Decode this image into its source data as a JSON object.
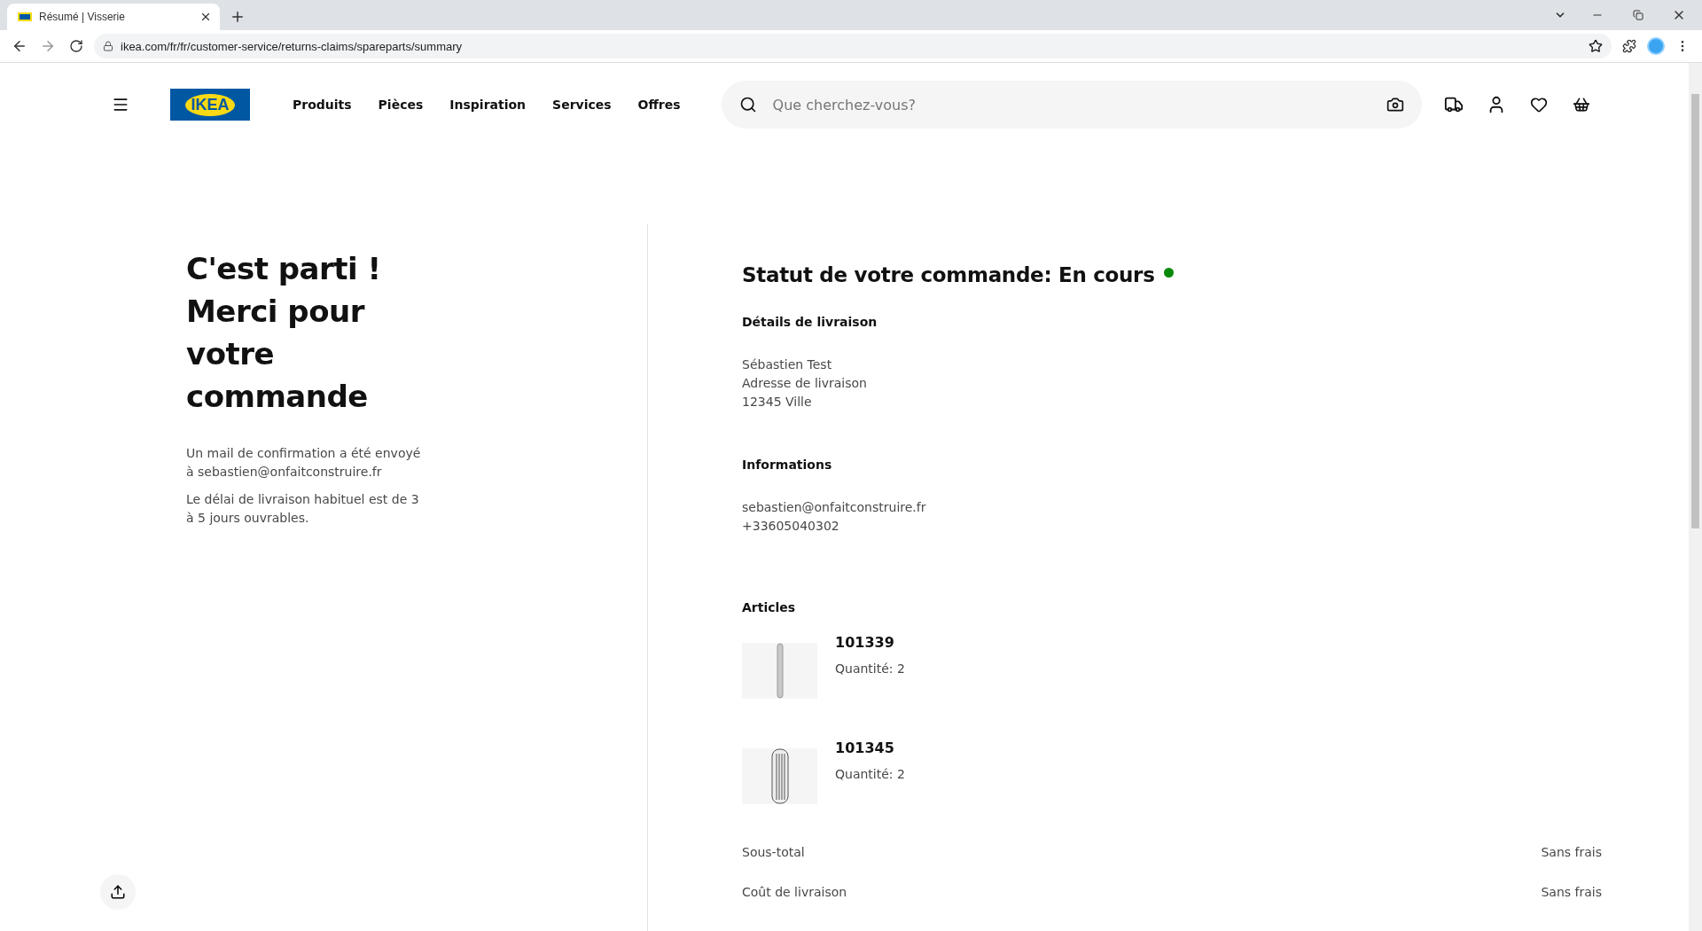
{
  "browser": {
    "tab_title": "Résumé | Visserie",
    "url": "ikea.com/fr/fr/customer-service/returns-claims/spareparts/summary"
  },
  "header": {
    "logo": "IKEA",
    "nav": [
      "Produits",
      "Pièces",
      "Inspiration",
      "Services",
      "Offres"
    ],
    "search": {
      "placeholder": "Que cherchez-vous?"
    }
  },
  "confirmation": {
    "title_lines": [
      "C'est parti !",
      "Merci pour",
      "votre",
      "commande"
    ],
    "paragraphs": [
      "Un mail de confirmation a été envoyé à sebastien@onfaitconstruire.fr",
      "Le délai de livraison habituel est de 3 à 5 jours ouvrables."
    ]
  },
  "order": {
    "status_label": "Statut de votre commande:",
    "status_value": "En cours",
    "delivery": {
      "heading": "Détails de livraison",
      "lines": [
        "Sébastien Test",
        "Adresse de livraison",
        "12345 Ville"
      ]
    },
    "info": {
      "heading": "Informations",
      "lines": [
        "sebastien@onfaitconstruire.fr",
        "+33605040302"
      ]
    },
    "articles_heading": "Articles",
    "articles": [
      {
        "kind": "pin",
        "ref": "101339",
        "quantity": "Quantité: 2"
      },
      {
        "kind": "dowel",
        "ref": "101345",
        "quantity": "Quantité: 2"
      }
    ],
    "summary": [
      {
        "label": "Sous-total",
        "value": "Sans frais"
      },
      {
        "label": "Coût de livraison",
        "value": "Sans frais"
      }
    ]
  }
}
